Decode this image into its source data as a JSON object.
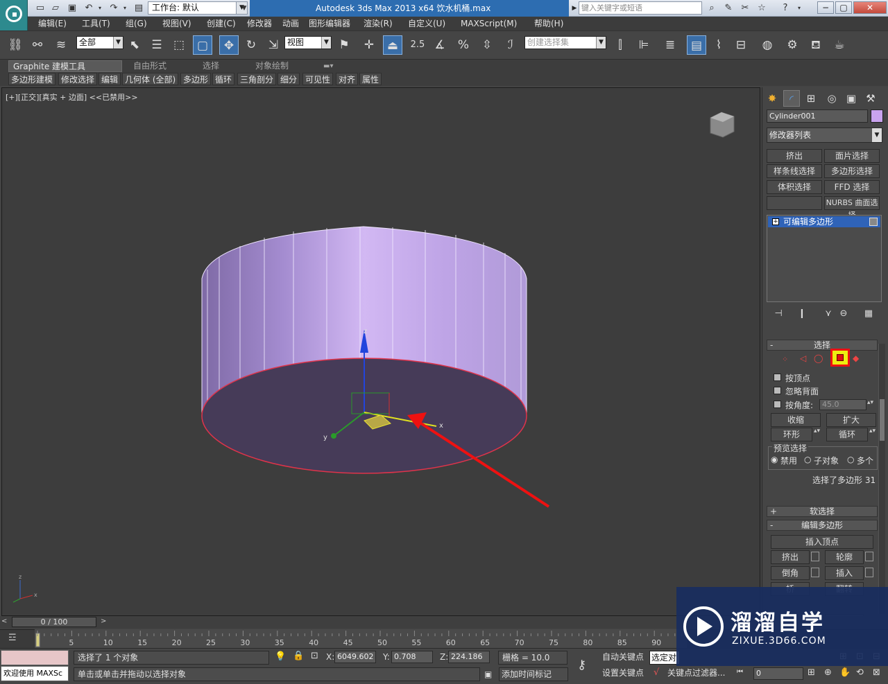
{
  "titlebar": {
    "workspace_label": "工作台: 默认",
    "title": "Autodesk 3ds Max  2013 x64      饮水机桶.max",
    "search_placeholder": "键入关键字或短语"
  },
  "menu": [
    "编辑(E)",
    "工具(T)",
    "组(G)",
    "视图(V)",
    "创建(C)",
    "修改器",
    "动画",
    "图形编辑器",
    "渲染(R)",
    "自定义(U)",
    "MAXScript(M)",
    "帮助(H)"
  ],
  "toolbar": {
    "filter_value": "全部",
    "ref_coord_value": "视图",
    "snap_angle_label": "2.5",
    "named_sel_placeholder": "创建选择集"
  },
  "ribbon": {
    "tabs": [
      "Graphite 建模工具",
      "自由形式",
      "选择",
      "对象绘制"
    ],
    "subtabs": [
      "多边形建模",
      "修改选择",
      "编辑",
      "几何体 (全部)",
      "多边形",
      "循环",
      "三角剖分",
      "细分",
      "可见性",
      "对齐",
      "属性"
    ]
  },
  "viewport": {
    "label": "[+][正交][真实 + 边面] <<已禁用>>",
    "gizmo_x": "x",
    "gizmo_y": "y",
    "gizmo_z": "z"
  },
  "command_panel": {
    "object_name": "Cylinder001",
    "object_color": "#c9a3ee",
    "modifier_list_label": "修改器列表",
    "modifier_buttons": [
      "挤出",
      "面片选择",
      "样条线选择",
      "多边形选择",
      "体积选择",
      "FFD 选择",
      "",
      "NURBS 曲面选择"
    ],
    "stack_item": "可编辑多边形",
    "selection_rollout": {
      "title": "选择",
      "by_vertex": "按顶点",
      "ignore_backfacing": "忽略背面",
      "by_angle": "按角度:",
      "angle_value": "45.0",
      "shrink": "收缩",
      "grow": "扩大",
      "ring": "环形",
      "loop": "循环",
      "preview_title": "预览选择",
      "preview_disabled": "禁用",
      "preview_subobject": "子对象",
      "preview_multi": "多个",
      "status": "选择了多边形 31"
    },
    "soft_selection_title": "软选择",
    "edit_polygons": {
      "title": "编辑多边形",
      "insert_vertex": "插入顶点",
      "extrude": "挤出",
      "outline": "轮廓",
      "bevel": "倒角",
      "inset": "插入",
      "flip": "翻转",
      "partial_1": "桥",
      "partial_2": "分"
    }
  },
  "timeline": {
    "frame_display": "0 / 100",
    "ticks": [
      "5",
      "10",
      "15",
      "20",
      "25",
      "30",
      "35",
      "40",
      "45",
      "50",
      "55",
      "60",
      "65",
      "70",
      "75",
      "80",
      "85",
      "90"
    ]
  },
  "statusbar": {
    "welcome": "欢迎使用 MAXSc",
    "selection_status": "选择了 1 个对象",
    "prompt": "单击或单击并拖动以选择对象",
    "x_label": "X:",
    "x_value": "6049.602",
    "y_label": "Y:",
    "y_value": "0.708",
    "z_label": "Z:",
    "z_value": "224.186",
    "grid": "栅格 = 10.0",
    "add_time_tag": "添加时间标记",
    "auto_key": "自动关键点",
    "set_key": "设置关键点",
    "selected_set": "选定对",
    "key_filters": "关键点过滤器...",
    "frame_value": "0"
  },
  "watermark": {
    "title": "溜溜自学",
    "url": "ZIXUE.3D66.COM"
  }
}
